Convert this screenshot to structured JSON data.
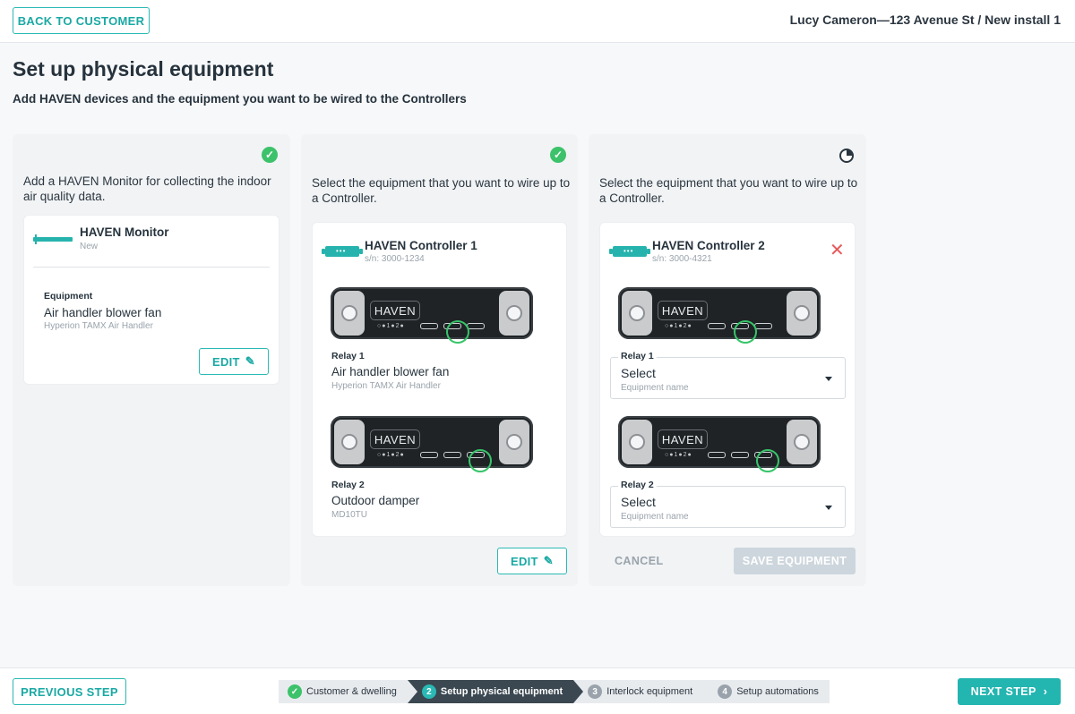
{
  "header": {
    "back_label": "BACK TO CUSTOMER",
    "breadcrumb": "Lucy Cameron—123 Avenue St / New install 1"
  },
  "page": {
    "title": "Set up physical equipment",
    "subtitle": "Add HAVEN devices and the equipment you want to be wired to the Controllers"
  },
  "monitor_panel": {
    "description": "Add a HAVEN Monitor for collecting the indoor air quality data.",
    "device_name": "HAVEN Monitor",
    "device_status": "New",
    "equipment_label": "Equipment",
    "equipment_name": "Air handler blower fan",
    "equipment_model": "Hyperion TAMX Air Handler",
    "edit_label": "EDIT",
    "status_icon": "check-circle-icon"
  },
  "controller1_panel": {
    "description": "Select the equipment that you want to wire up to a Controller.",
    "device_name": "HAVEN Controller 1",
    "serial": "s/n: 3000-1234",
    "controller_logo": "HAVEN",
    "relay1_label": "Relay 1",
    "relay1_name": "Air handler blower fan",
    "relay1_model": "Hyperion TAMX Air Handler",
    "relay2_label": "Relay 2",
    "relay2_name": "Outdoor damper",
    "relay2_model": "MD10TU",
    "edit_label": "EDIT",
    "status_icon": "check-circle-icon"
  },
  "controller2_panel": {
    "description": "Select the equipment that you want to wire up to a Controller.",
    "device_name": "HAVEN Controller 2",
    "serial": "s/n: 3000-4321",
    "controller_logo": "HAVEN",
    "relay1_label": "Relay 1",
    "relay1_value": "Select",
    "relay1_hint": "Equipment name",
    "relay2_label": "Relay 2",
    "relay2_value": "Select",
    "relay2_hint": "Equipment name",
    "cancel_label": "CANCEL",
    "save_label": "SAVE EQUIPMENT",
    "status_icon": "in-progress-icon"
  },
  "footer": {
    "prev_label": "PREVIOUS STEP",
    "next_label": "NEXT STEP",
    "steps": [
      {
        "num": "",
        "label": "Customer & dwelling",
        "state": "done"
      },
      {
        "num": "2",
        "label": "Setup physical equipment",
        "state": "active"
      },
      {
        "num": "3",
        "label": "Interlock equipment",
        "state": "pending"
      },
      {
        "num": "4",
        "label": "Setup automations",
        "state": "pending"
      }
    ]
  },
  "colors": {
    "accent": "#23b5b0",
    "success": "#3cc26a",
    "danger": "#e8585a",
    "disabled": "#cdd6dd"
  }
}
